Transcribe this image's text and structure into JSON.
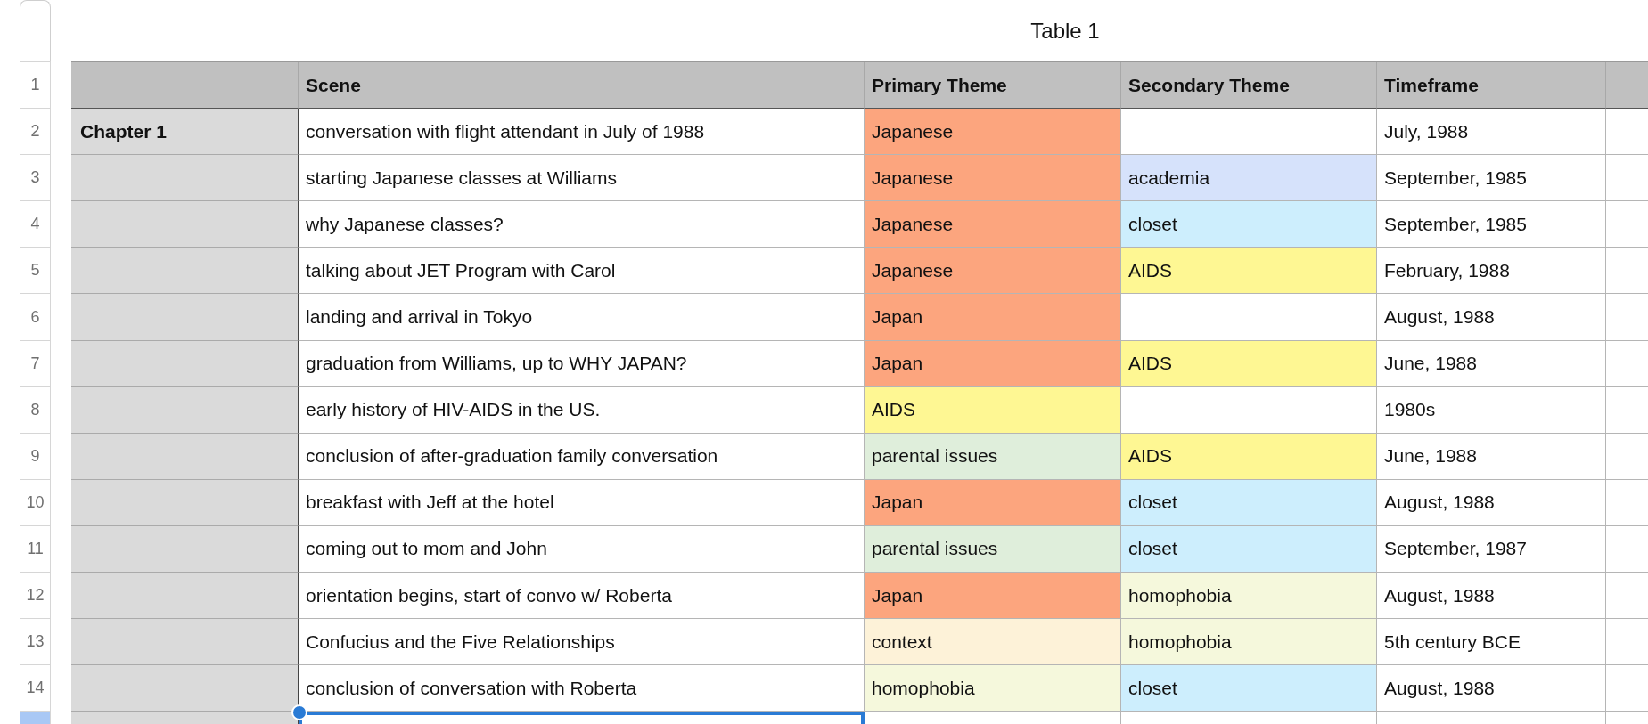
{
  "table": {
    "title": "Table 1",
    "columns": [
      "Scene",
      "Primary Theme",
      "Secondary Theme",
      "Timeframe"
    ],
    "header_row_number": "1",
    "rows": [
      {
        "number": "2",
        "chapter": "Chapter 1",
        "scene": "conversation with flight attendant in July of 1988",
        "primary": {
          "text": "Japanese",
          "color": "#fca57e"
        },
        "timeframe": "July, 1988",
        "selected": false
      },
      {
        "number": "3",
        "scene": "starting Japanese classes at Williams",
        "primary": {
          "text": "Japanese",
          "color": "#fca57e"
        },
        "secondary": {
          "text": "academia",
          "color": "#d6e2fb"
        },
        "timeframe": "September, 1985",
        "selected": false
      },
      {
        "number": "4",
        "scene": "why Japanese classes?",
        "primary": {
          "text": "Japanese",
          "color": "#fca57e"
        },
        "secondary": {
          "text": "closet",
          "color": "#cdeefd"
        },
        "timeframe": "September, 1985",
        "selected": false
      },
      {
        "number": "5",
        "scene": "talking about JET Program with Carol",
        "primary": {
          "text": "Japanese",
          "color": "#fca57e"
        },
        "secondary": {
          "text": "AIDS",
          "color": "#fef793"
        },
        "timeframe": "February, 1988",
        "selected": false
      },
      {
        "number": "6",
        "scene": "landing and arrival in Tokyo",
        "primary": {
          "text": "Japan",
          "color": "#fca57e"
        },
        "timeframe": "August, 1988",
        "selected": false
      },
      {
        "number": "7",
        "scene": "graduation from Williams, up to WHY JAPAN?",
        "primary": {
          "text": "Japan",
          "color": "#fca57e"
        },
        "secondary": {
          "text": "AIDS",
          "color": "#fef793"
        },
        "timeframe": "June, 1988",
        "selected": false
      },
      {
        "number": "8",
        "scene": "early history of HIV-AIDS in the US.",
        "primary": {
          "text": "AIDS",
          "color": "#fef793"
        },
        "timeframe": "1980s",
        "selected": false
      },
      {
        "number": "9",
        "scene": "conclusion of after-graduation family conversation",
        "primary": {
          "text": "parental issues",
          "color": "#dfeedb"
        },
        "secondary": {
          "text": "AIDS",
          "color": "#fef793"
        },
        "timeframe": "June, 1988",
        "selected": false
      },
      {
        "number": "10",
        "scene": "breakfast with Jeff at the hotel",
        "primary": {
          "text": "Japan",
          "color": "#fca57e"
        },
        "secondary": {
          "text": "closet",
          "color": "#cdeefd"
        },
        "timeframe": "August, 1988",
        "selected": false
      },
      {
        "number": "11",
        "scene": "coming out to mom and John",
        "primary": {
          "text": "parental issues",
          "color": "#dfeedb"
        },
        "secondary": {
          "text": "closet",
          "color": "#cdeefd"
        },
        "timeframe": "September, 1987",
        "selected": false
      },
      {
        "number": "12",
        "scene": "orientation begins, start of convo w/ Roberta",
        "primary": {
          "text": "Japan",
          "color": "#fca57e"
        },
        "secondary": {
          "text": "homophobia",
          "color": "#f5f8dc"
        },
        "timeframe": "August, 1988",
        "selected": false
      },
      {
        "number": "13",
        "scene": "Confucius and the Five Relationships",
        "primary": {
          "text": "context",
          "color": "#fdf2d8"
        },
        "secondary": {
          "text": "homophobia",
          "color": "#f5f8dc"
        },
        "timeframe": "5th century BCE",
        "selected": false
      },
      {
        "number": "14",
        "scene": "conclusion of conversation with Roberta",
        "primary": {
          "text": "homophobia",
          "color": "#f5f8dc"
        },
        "secondary": {
          "text": "closet",
          "color": "#cdeefd"
        },
        "timeframe": "August, 1988",
        "selected": false
      },
      {
        "selected": true
      }
    ]
  }
}
